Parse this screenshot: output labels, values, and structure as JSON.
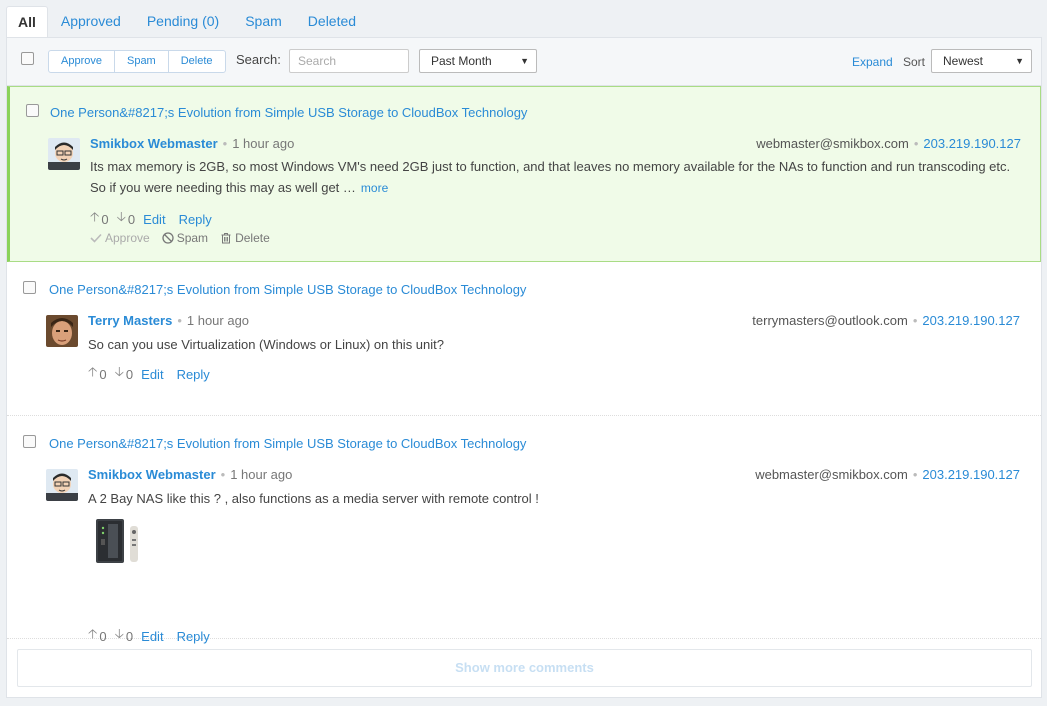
{
  "tabs": [
    {
      "label": "All",
      "active": true
    },
    {
      "label": "Approved",
      "active": false
    },
    {
      "label": "Pending (0)",
      "active": false
    },
    {
      "label": "Spam",
      "active": false
    },
    {
      "label": "Deleted",
      "active": false
    }
  ],
  "toolbar": {
    "bulk_actions": [
      "Approve",
      "Spam",
      "Delete"
    ],
    "search_label": "Search:",
    "search_placeholder": "Search",
    "search_value": "",
    "date_filter": "Past Month",
    "expand_label": "Expand",
    "sort_label": "Sort",
    "sort_value": "Newest"
  },
  "comments": [
    {
      "post_title": "One Person&#8217;s Evolution from Simple USB Storage to CloudBox Technology",
      "author": "Smikbox Webmaster",
      "time": "1 hour ago",
      "email": "webmaster@smikbox.com",
      "ip": "203.219.190.127",
      "body_line1": "Its max memory is 2GB, so most Windows VM's need 2GB just to function, and that leaves no memory available for the NAs to function and run transcoding etc.",
      "body_line2": "So if you were needing this may as well get …",
      "more_label": "more",
      "upvotes": "0",
      "downvotes": "0",
      "edit_label": "Edit",
      "reply_label": "Reply",
      "approve_label": "Approve",
      "spam_label": "Spam",
      "delete_label": "Delete",
      "highlighted": true
    },
    {
      "post_title": "One Person&#8217;s Evolution from Simple USB Storage to CloudBox Technology",
      "author": "Terry Masters",
      "time": "1 hour ago",
      "email": "terrymasters@outlook.com",
      "ip": "203.219.190.127",
      "body": "So can you use Virtualization (Windows or Linux) on this unit?",
      "upvotes": "0",
      "downvotes": "0",
      "edit_label": "Edit",
      "reply_label": "Reply"
    },
    {
      "post_title": "One Person&#8217;s Evolution from Simple USB Storage to CloudBox Technology",
      "author": "Smikbox Webmaster",
      "time": "1 hour ago",
      "email": "webmaster@smikbox.com",
      "ip": "203.219.190.127",
      "body": "A 2 Bay NAS like this ? , also functions as a media server with remote control !",
      "upvotes": "0",
      "downvotes": "0",
      "edit_label": "Edit",
      "reply_label": "Reply"
    }
  ],
  "show_more_label": "Show more comments",
  "colors": {
    "link": "#2a8bd6",
    "highlight_bg": "#f0fbe8",
    "highlight_border": "#8bd25b"
  }
}
